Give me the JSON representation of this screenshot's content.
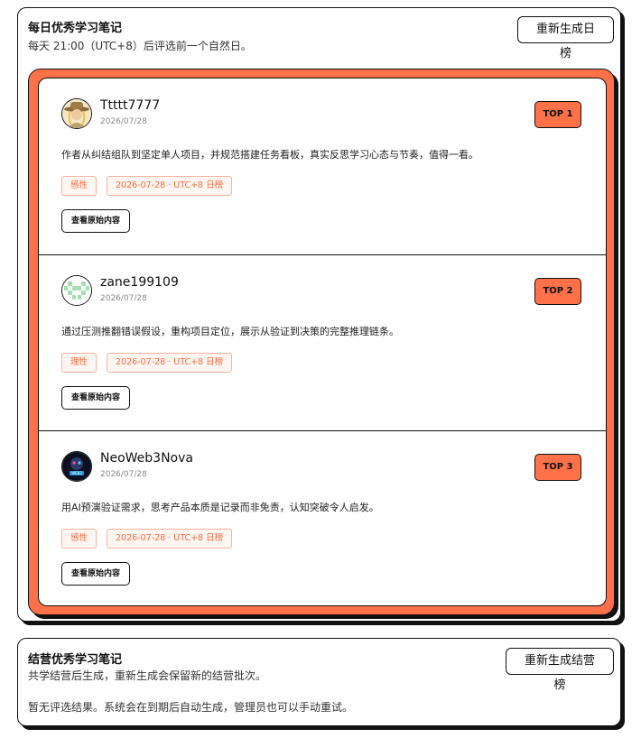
{
  "daily": {
    "title": "每日优秀学习笔记",
    "subtitle": "每天 21:00（UTC+8）后评选前一个自然日。",
    "regenerate_label": "重新生成日榜",
    "entries": [
      {
        "username": "Ttttt7777",
        "date": "2026/07/28",
        "rank": "TOP 1",
        "summary": "作者从纠结组队到坚定单人项目，并规范搭建任务看板，真实反思学习心态与节奏，值得一看。",
        "tag_mood": "感性",
        "tag_date": "2026-07-28 · UTC+8 日榜",
        "view_label": "查看原始内容",
        "avatar_icon": "cowboy-avatar-icon"
      },
      {
        "username": "zane199109",
        "date": "2026/07/28",
        "rank": "TOP 2",
        "summary": "通过压测推翻错误假设，重构项目定位，展示从验证到决策的完整推理链条。",
        "tag_mood": "理性",
        "tag_date": "2026-07-28 · UTC+8 日榜",
        "view_label": "查看原始内容",
        "avatar_icon": "pixel-identicon-avatar-icon"
      },
      {
        "username": "NeoWeb3Nova",
        "date": "2026/07/28",
        "rank": "TOP 3",
        "summary": "用AI预演验证需求，思考产品本质是记录而非免责，认知突破令人启发。",
        "tag_mood": "感性",
        "tag_date": "2026-07-28 · UTC+8 日榜",
        "view_label": "查看原始内容",
        "avatar_icon": "web3-avatar-icon"
      }
    ]
  },
  "camp": {
    "title": "结营优秀学习笔记",
    "subtitle": "共学结营后生成，重新生成会保留新的结营批次。",
    "regenerate_label": "重新生成结营榜",
    "empty_message": "暂无评选结果。系统会在到期后自动生成，管理员也可以手动重试。"
  },
  "colors": {
    "accent": "#ff7148",
    "tag_text": "#ff6a3d",
    "tag_border": "#f7b39d",
    "tag_bg": "#fff6f2",
    "border": "#111111"
  }
}
